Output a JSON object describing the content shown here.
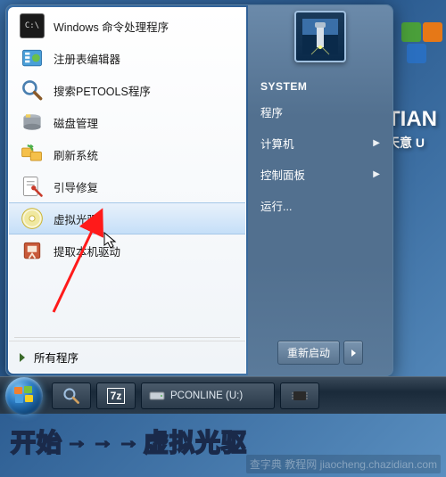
{
  "desktop": {
    "brand": "TIAN",
    "brand_sub": "天意 U"
  },
  "start_menu": {
    "left_items": [
      {
        "label": "Windows 命令处理程序",
        "icon": "cmd-icon"
      },
      {
        "label": "注册表编辑器",
        "icon": "regedit-icon"
      },
      {
        "label": "搜索PETOOLS程序",
        "icon": "search-icon"
      },
      {
        "label": "磁盘管理",
        "icon": "diskmgmt-icon"
      },
      {
        "label": "刷新系统",
        "icon": "refresh-icon"
      },
      {
        "label": "引导修复",
        "icon": "bootrepair-icon"
      },
      {
        "label": "虚拟光驱",
        "icon": "virtualdrive-icon"
      },
      {
        "label": "提取本机驱动",
        "icon": "driverbackup-icon"
      }
    ],
    "all_programs": "所有程序",
    "right": {
      "user": "SYSTEM",
      "items": [
        {
          "label": "程序"
        },
        {
          "label": "计算机",
          "submenu": true
        },
        {
          "label": "控制面板",
          "submenu": true
        },
        {
          "label": "运行..."
        }
      ],
      "restart": "重新启动"
    }
  },
  "taskbar": {
    "drive_label": "PCONLINE (U:)"
  },
  "caption": {
    "text_start": "开始",
    "text_target": "虚拟光驱"
  },
  "watermark": "查字典 教程网 jiaocheng.chazidian.com"
}
